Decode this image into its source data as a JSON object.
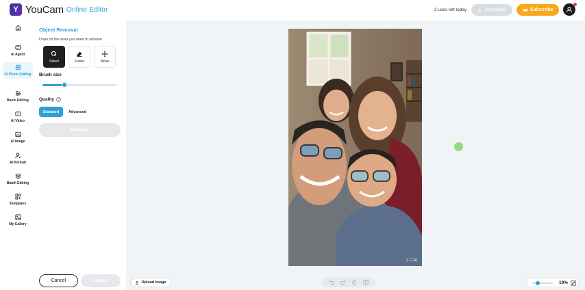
{
  "header": {
    "app_name": "YouCam",
    "app_sub": "Online Editor",
    "uses_left": "3 uses left today",
    "download_label": "Download",
    "subscribe_label": "Subscribe"
  },
  "nav": {
    "items": [
      {
        "label": "AI Agent"
      },
      {
        "label": "AI Photo Editing"
      },
      {
        "label": "Basic Editing"
      },
      {
        "label": "AI Video"
      },
      {
        "label": "AI Image"
      },
      {
        "label": "AI Portrait"
      },
      {
        "label": "Batch Editing"
      },
      {
        "label": "Templates"
      },
      {
        "label": "My Gallery"
      }
    ],
    "active_index": 1
  },
  "panel": {
    "title": "Object Removal",
    "subtitle": "Draw on the area you want to remove",
    "tools": [
      {
        "label": "Select",
        "icon": "select-icon",
        "active": true
      },
      {
        "label": "Eraser",
        "icon": "eraser-icon",
        "active": false
      },
      {
        "label": "Move",
        "icon": "move-icon",
        "active": false
      }
    ],
    "brush_size_label": "Brush size",
    "brush_size_fraction": 0.3,
    "quality_label": "Quality",
    "quality_options": [
      "Standard",
      "Advanced"
    ],
    "quality_selected": "Standard",
    "remove_label": "Remove",
    "cancel_label": "Cancel",
    "apply_label": "Apply"
  },
  "canvas": {
    "upload_label": "Upload Image",
    "zoom_value": "19%",
    "zoom_fraction": 0.19,
    "watermark": "ᛒ二AI"
  },
  "colors": {
    "accent": "#2f9fd8",
    "subscribe": "#f7a81b",
    "disabled": "#d9dde2",
    "canvas_bg": "#f1f4f6"
  }
}
